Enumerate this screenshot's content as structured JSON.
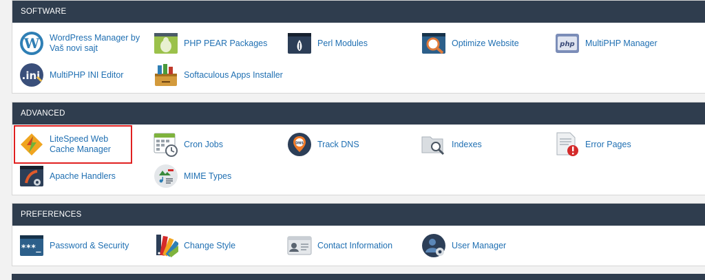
{
  "sections": {
    "software": {
      "title": "SOFTWARE",
      "items": [
        {
          "label": "WordPress Manager by Vaš novi sajt",
          "icon": "wordpress-icon"
        },
        {
          "label": "PHP PEAR Packages",
          "icon": "pear-icon"
        },
        {
          "label": "Perl Modules",
          "icon": "perl-icon"
        },
        {
          "label": "Optimize Website",
          "icon": "optimize-icon"
        },
        {
          "label": "MultiPHP Manager",
          "icon": "php-icon"
        },
        {
          "label": "MultiPHP INI Editor",
          "icon": "ini-icon"
        },
        {
          "label": "Softaculous Apps Installer",
          "icon": "softaculous-icon"
        }
      ]
    },
    "advanced": {
      "title": "ADVANCED",
      "items": [
        {
          "label": "LiteSpeed Web Cache Manager",
          "icon": "litespeed-icon"
        },
        {
          "label": "Cron Jobs",
          "icon": "calendar-clock-icon"
        },
        {
          "label": "Track DNS",
          "icon": "dns-pin-icon"
        },
        {
          "label": "Indexes",
          "icon": "folder-search-icon"
        },
        {
          "label": "Error Pages",
          "icon": "error-page-icon"
        },
        {
          "label": "Apache Handlers",
          "icon": "apache-handler-icon"
        },
        {
          "label": "MIME Types",
          "icon": "mime-types-icon"
        }
      ]
    },
    "preferences": {
      "title": "PREFERENCES",
      "items": [
        {
          "label": "Password & Security",
          "icon": "password-icon"
        },
        {
          "label": "Change Style",
          "icon": "palette-icon"
        },
        {
          "label": "Contact Information",
          "icon": "contact-card-icon"
        },
        {
          "label": "User Manager",
          "icon": "user-gear-icon"
        }
      ]
    }
  }
}
